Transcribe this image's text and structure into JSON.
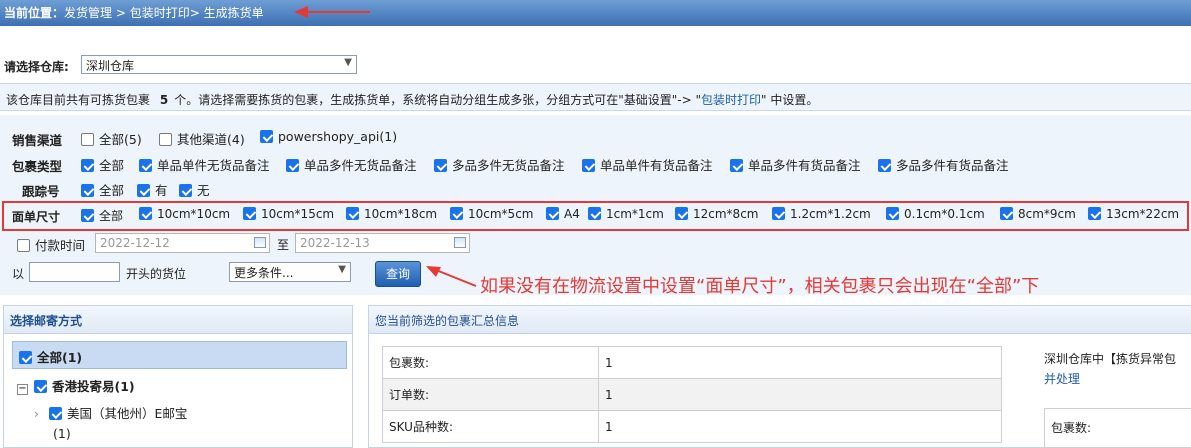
{
  "breadcrumb": {
    "label": "当前位置：",
    "path": "发货管理 > 包装时打印> 生成拣货单"
  },
  "warehouse": {
    "label": "请选择仓库:",
    "selected": "深圳仓库"
  },
  "notice": {
    "part1": "该仓库目前共有可拣货包裹",
    "count": "5",
    "part2": "个。请选择需要拣货的包裹，生成拣货单，系统将自动分组生成多张，分组方式可在\"基础设置\"-> \"",
    "link": "包装时打印",
    "part3": "\" 中设置。"
  },
  "filters": {
    "channel": {
      "label": "销售渠道",
      "options": [
        {
          "label": "全部(5)",
          "checked": false
        },
        {
          "label": "其他渠道(4)",
          "checked": false
        },
        {
          "label": "powershopy_api(1)",
          "checked": true
        }
      ]
    },
    "package_type": {
      "label": "包裹类型",
      "options": [
        {
          "label": "全部",
          "checked": true
        },
        {
          "label": "单品单件无货品备注",
          "checked": true
        },
        {
          "label": "单品多件无货品备注",
          "checked": true
        },
        {
          "label": "多品多件无货品备注",
          "checked": true
        },
        {
          "label": "单品单件有货品备注",
          "checked": true
        },
        {
          "label": "单品多件有货品备注",
          "checked": true
        },
        {
          "label": "多品多件有货品备注",
          "checked": true
        }
      ]
    },
    "tracking": {
      "label": "跟踪号",
      "options": [
        {
          "label": "全部",
          "checked": true
        },
        {
          "label": "有",
          "checked": true
        },
        {
          "label": "无",
          "checked": true
        }
      ]
    },
    "label_size": {
      "label": "面单尺寸",
      "options": [
        {
          "label": "全部",
          "checked": true
        },
        {
          "label": "10cm*10cm",
          "checked": true
        },
        {
          "label": "10cm*15cm",
          "checked": true
        },
        {
          "label": "10cm*18cm",
          "checked": true
        },
        {
          "label": "10cm*5cm",
          "checked": true
        },
        {
          "label": "A4",
          "checked": true
        },
        {
          "label": "1cm*1cm",
          "checked": true
        },
        {
          "label": "12cm*8cm",
          "checked": true
        },
        {
          "label": "1.2cm*1.2cm",
          "checked": true
        },
        {
          "label": "0.1cm*0.1cm",
          "checked": true
        },
        {
          "label": "8cm*9cm",
          "checked": true
        },
        {
          "label": "13cm*22cm",
          "checked": true
        }
      ]
    },
    "pay_time": {
      "label": "付款时间",
      "checked": false,
      "from": "2022-12-12",
      "to_label": "至",
      "to": "2022-12-13"
    },
    "location": {
      "prefix": "以",
      "suffix": "开头的货位",
      "more": "更多条件...",
      "query": "查询"
    }
  },
  "annotation": "如果没有在物流设置中设置“面单尺寸”，相关包裹只会出现在“全部”下",
  "left_panel": {
    "title": "选择邮寄方式",
    "all": "全部(1)",
    "groups": [
      {
        "label": "香港投寄易(1)",
        "children": [
          {
            "label": "美国（其他州）E邮宝",
            "count": "(1)"
          }
        ]
      }
    ]
  },
  "right_panel": {
    "title": "您当前筛选的包裹汇总信息",
    "summary": [
      {
        "key": "包裹数:",
        "value": "1"
      },
      {
        "key": "订单数:",
        "value": "1"
      },
      {
        "key": "SKU品种数:",
        "value": "1"
      }
    ],
    "note_line1": "深圳仓库中【拣货异常包",
    "note_link": "并处理",
    "side_key": "包裹数:"
  },
  "colors": {
    "header_blue": "#3d70b3",
    "accent_red": "#e53935",
    "checkbox_blue": "#1a73e8",
    "link_blue": "#1d5fa8"
  }
}
